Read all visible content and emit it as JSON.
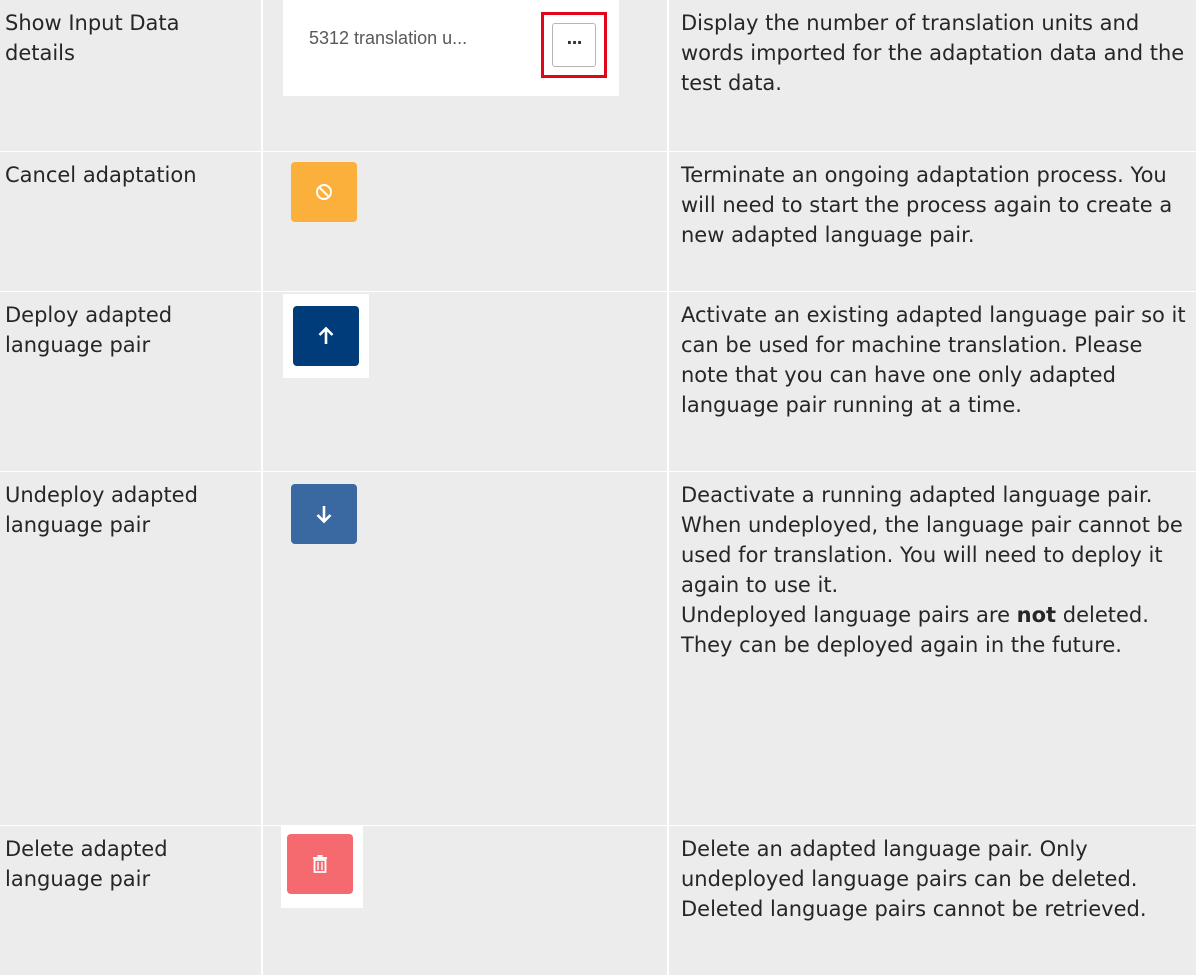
{
  "rows": [
    {
      "action": "Show Input Data details",
      "widget_text": "5312 translation u...",
      "widget_button_icon": "more-icon",
      "description": "Display the number of translation units and words imported for the adaptation data and the test data."
    },
    {
      "action": "Cancel adaptation",
      "icon": "cancel-icon",
      "icon_color": "#fbb03b",
      "description": "Terminate an ongoing adaptation process. You will need to start the process again to create a new adapted language pair."
    },
    {
      "action": "Deploy adapted language pair",
      "icon": "arrow-up-icon",
      "icon_color": "#003b7a",
      "description": "Activate an existing adapted language pair so it can be used for machine translation. Please note that you can have one only adapted language pair running at a time."
    },
    {
      "action": "Undeploy adapted language pair",
      "icon": "arrow-down-icon",
      "icon_color": "#3a68a1",
      "description_parts": {
        "before": "Deactivate a running adapted language pair.\nWhen undeployed, the language pair cannot be used for translation. You will need to deploy it again to use it.\nUndeployed language pairs are ",
        "bold": "not",
        "after": " deleted. They can be deployed again in the future."
      }
    },
    {
      "action": "Delete adapted language pair",
      "icon": "trash-icon",
      "icon_color": "#f46a6f",
      "description": "Delete an adapted language pair. Only undeployed language pairs can be deleted. Deleted language pairs cannot be retrieved."
    }
  ]
}
